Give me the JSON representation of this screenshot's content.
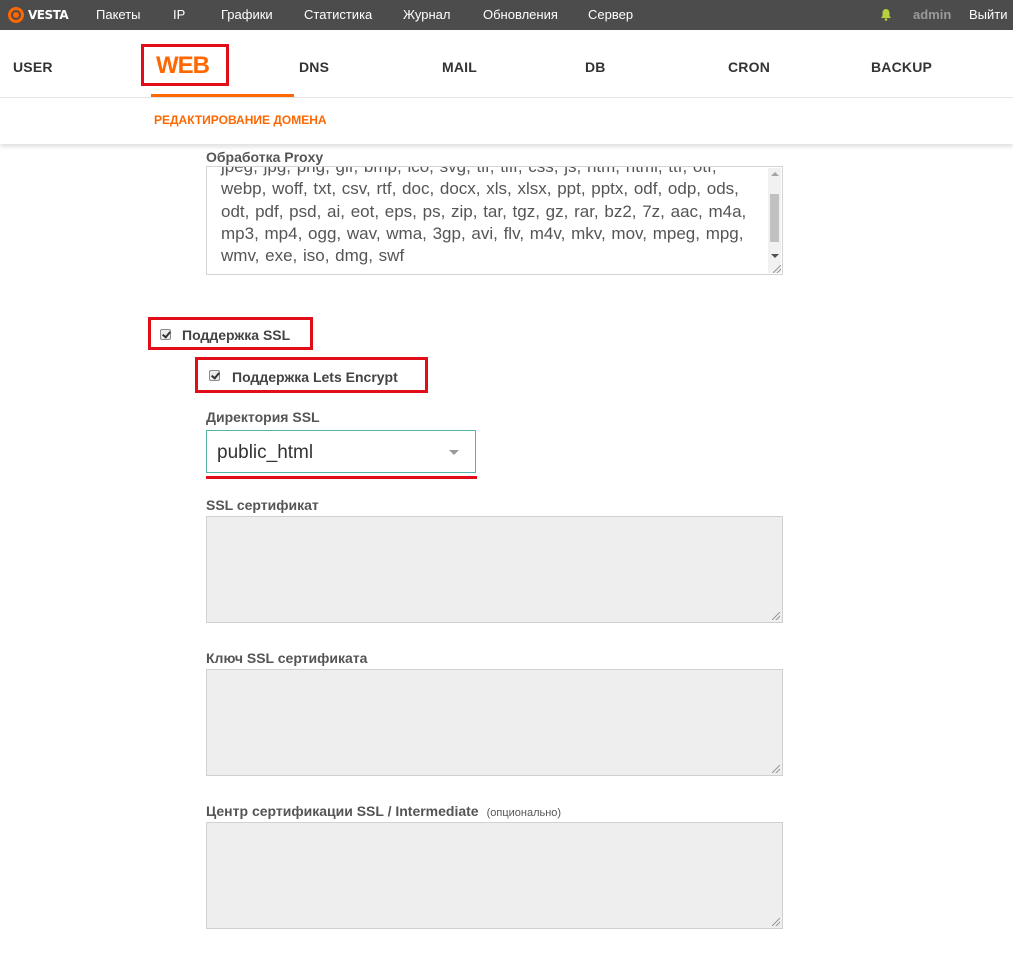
{
  "topbar": {
    "logo_text": "VESTA",
    "nav": [
      "Пакеты",
      "IP",
      "Графики",
      "Статистика",
      "Журнал",
      "Обновления",
      "Сервер"
    ],
    "user": "admin",
    "logout": "Выйти"
  },
  "tabs": {
    "user": "USER",
    "web": "WEB",
    "dns": "DNS",
    "mail": "MAIL",
    "db": "DB",
    "cron": "CRON",
    "backup": "BACKUP"
  },
  "subheader": {
    "title": "РЕДАКТИРОВАНИЕ ДОМЕНА"
  },
  "form": {
    "proxy_label": "Обработка Proxy",
    "proxy_extensions": "jpeg, jpg, png, gif, bmp, ico, svg, tif, tiff, css, js, htm, html, ttf, otf, webp, woff, txt, csv, rtf, doc, docx, xls, xlsx, ppt, pptx, odf, odp, ods, odt, pdf, psd, ai, eot, eps, ps, zip, tar, tgz, gz, rar, bz2, 7z, aac, m4a, mp3, mp4, ogg, wav, wma, 3gp, avi, flv, m4v, mkv, mov, mpeg, mpg, wmv, exe, iso, dmg, swf",
    "ssl_support_label": "Поддержка SSL",
    "ssl_support_checked": true,
    "lets_encrypt_label": "Поддержка Lets Encrypt",
    "lets_encrypt_checked": true,
    "ssl_dir_label": "Директория SSL",
    "ssl_dir_value": "public_html",
    "ssl_cert_label": "SSL сертификат",
    "ssl_key_label": "Ключ SSL сертификата",
    "ssl_ca_label": "Центр сертификации SSL / Intermediate",
    "ssl_ca_optional": "(опционально)"
  },
  "colors": {
    "accent": "#ff6701",
    "highlight": "#e10e19",
    "topbar": "#4c4c4c",
    "select_border": "#54b5a6"
  }
}
